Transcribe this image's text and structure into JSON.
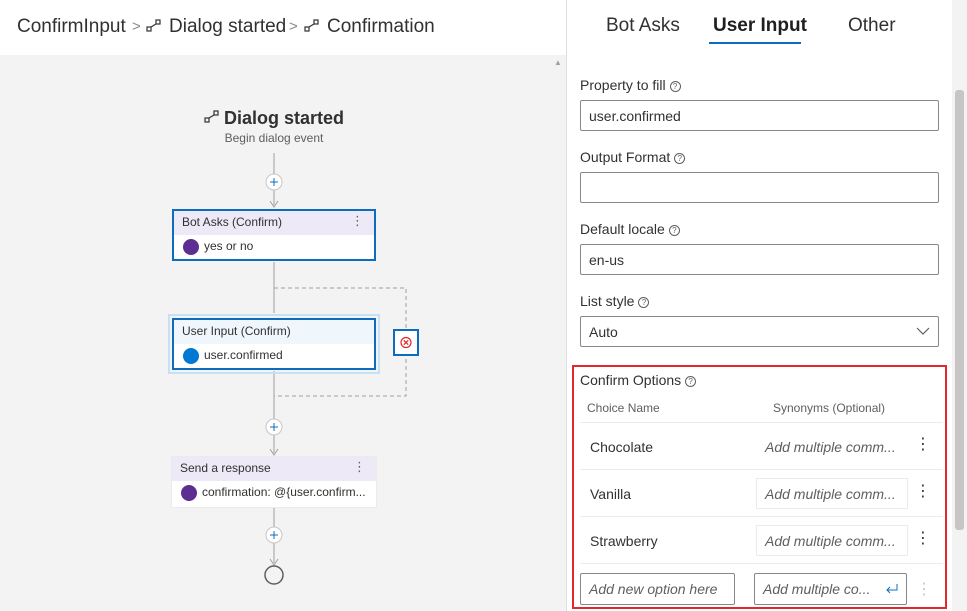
{
  "breadcrumb": {
    "items": [
      "ConfirmInput",
      "Dialog started",
      "Confirmation"
    ],
    "separator": ">"
  },
  "canvas": {
    "trigger": {
      "title": "Dialog started",
      "subtitle": "Begin dialog event"
    },
    "nodes": [
      {
        "header": "Bot Asks (Confirm)",
        "body": "yes or no",
        "avatar_color": "#5c2e91"
      },
      {
        "header": "User Input (Confirm)",
        "body": "user.confirmed",
        "avatar_color": "#0078d4"
      },
      {
        "header": "Send a response",
        "body": "confirmation: @{user.confirm...",
        "avatar_color": "#5c2e91"
      }
    ]
  },
  "panel": {
    "tabs": [
      {
        "label": "Bot Asks",
        "active": false
      },
      {
        "label": "User Input",
        "active": true
      },
      {
        "label": "Other",
        "active": false
      }
    ],
    "fields": {
      "property": {
        "label": "Property to fill",
        "value": "user.confirmed"
      },
      "output_format": {
        "label": "Output Format",
        "value": ""
      },
      "default_locale": {
        "label": "Default locale",
        "value": "en-us"
      },
      "list_style": {
        "label": "List style",
        "value": "Auto"
      }
    },
    "confirm_options": {
      "label": "Confirm Options",
      "columns": [
        "Choice Name",
        "Synonyms (Optional)"
      ],
      "rows": [
        {
          "name": "Chocolate",
          "synonyms_placeholder": "Add multiple comm..."
        },
        {
          "name": "Vanilla",
          "synonyms_placeholder": "Add multiple comm..."
        },
        {
          "name": "Strawberry",
          "synonyms_placeholder": "Add multiple comm..."
        }
      ],
      "new_option_placeholder": "Add new option here",
      "new_synonyms_placeholder": "Add multiple co..."
    }
  },
  "colors": {
    "accent": "#0f6cbd",
    "highlight": "#e0282e",
    "node_header": "#ede9f6"
  }
}
